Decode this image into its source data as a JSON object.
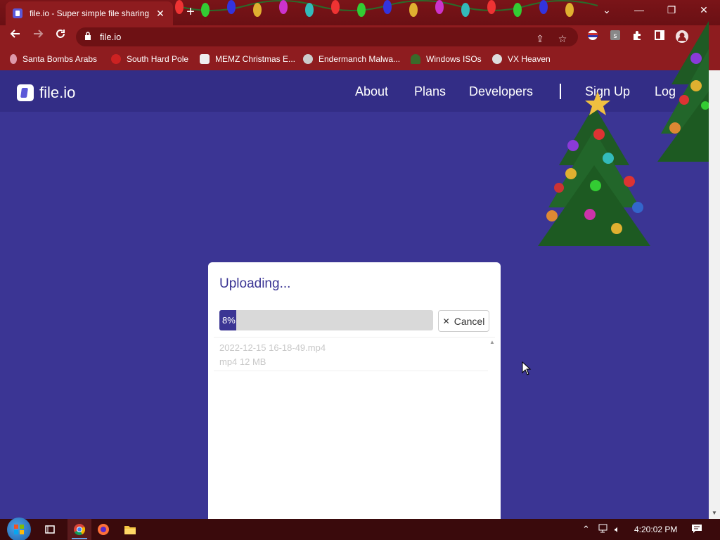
{
  "browser": {
    "tab_title": "file.io - Super simple file sharing",
    "tab_close": "✕",
    "new_tab": "+",
    "url": "file.io",
    "window_controls": {
      "tabsearch": "⌄",
      "minimize": "—",
      "restore": "❐",
      "close": "✕"
    },
    "bookmarks": [
      {
        "label": "Santa Bombs Arabs",
        "icon": "candle-icon"
      },
      {
        "label": "South Hard Pole",
        "icon": "star-icon"
      },
      {
        "label": "MEMZ Christmas E...",
        "icon": "page-icon"
      },
      {
        "label": "Endermanch Malwa...",
        "icon": "skull-icon"
      },
      {
        "label": "Windows ISOs",
        "icon": "tree-icon"
      },
      {
        "label": "VX Heaven",
        "icon": "radioactive-icon"
      }
    ]
  },
  "site": {
    "brand": "file.io",
    "nav": [
      "About",
      "Plans",
      "Developers",
      "Sign Up",
      "Log"
    ]
  },
  "upload": {
    "heading": "Uploading...",
    "progress_percent": 8,
    "progress_label": "8%",
    "cancel_label": "Cancel",
    "file": {
      "name": "2022-12-15 16-18-49.mp4",
      "meta": "mp4 12 MB"
    }
  },
  "taskbar": {
    "clock": "4:20:02 PM"
  },
  "colors": {
    "brand_purple": "#3b3594",
    "header_purple": "#332d86",
    "chrome_red": "#8e1c1f"
  }
}
